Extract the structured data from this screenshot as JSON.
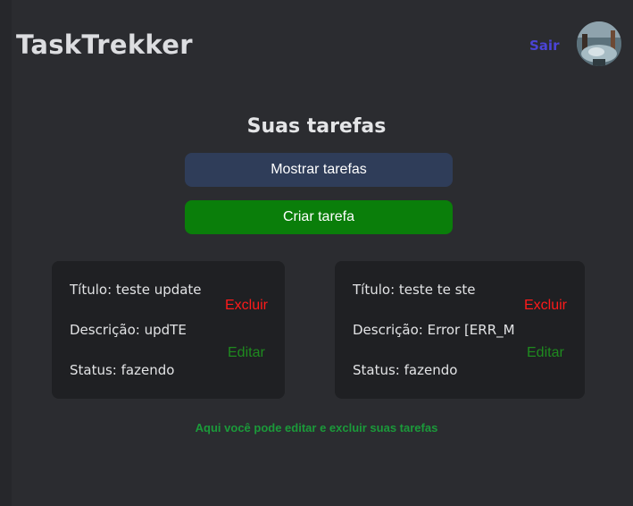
{
  "header": {
    "brand": "TaskTrekker",
    "logout_label": "Sair",
    "avatar_icon": "user-avatar"
  },
  "main": {
    "title": "Suas tarefas",
    "show_tasks_label": "Mostrar tarefas",
    "create_task_label": "Criar tarefa",
    "tasks": [
      {
        "title_text": "Título: teste update",
        "description_text": "Descrição: updTE",
        "status_text": "Status: fazendo",
        "delete_label": "Excluir",
        "edit_label": "Editar"
      },
      {
        "title_text": "Título: teste te ste",
        "description_text": "Descrição: Error [ERR_M",
        "status_text": "Status: fazendo",
        "delete_label": "Excluir",
        "edit_label": "Editar"
      }
    ],
    "footnote": "Aqui você pode editar e excluir suas tarefas"
  },
  "colors": {
    "background": "#2b2c30",
    "card": "#1f2023",
    "accent_logout": "#4b44d6",
    "show_button": "#2f3d59",
    "create_button": "#0a7e0a",
    "delete": "#ff1a1a",
    "edit": "#1f8a1f",
    "footnote": "#1b9a3a"
  }
}
